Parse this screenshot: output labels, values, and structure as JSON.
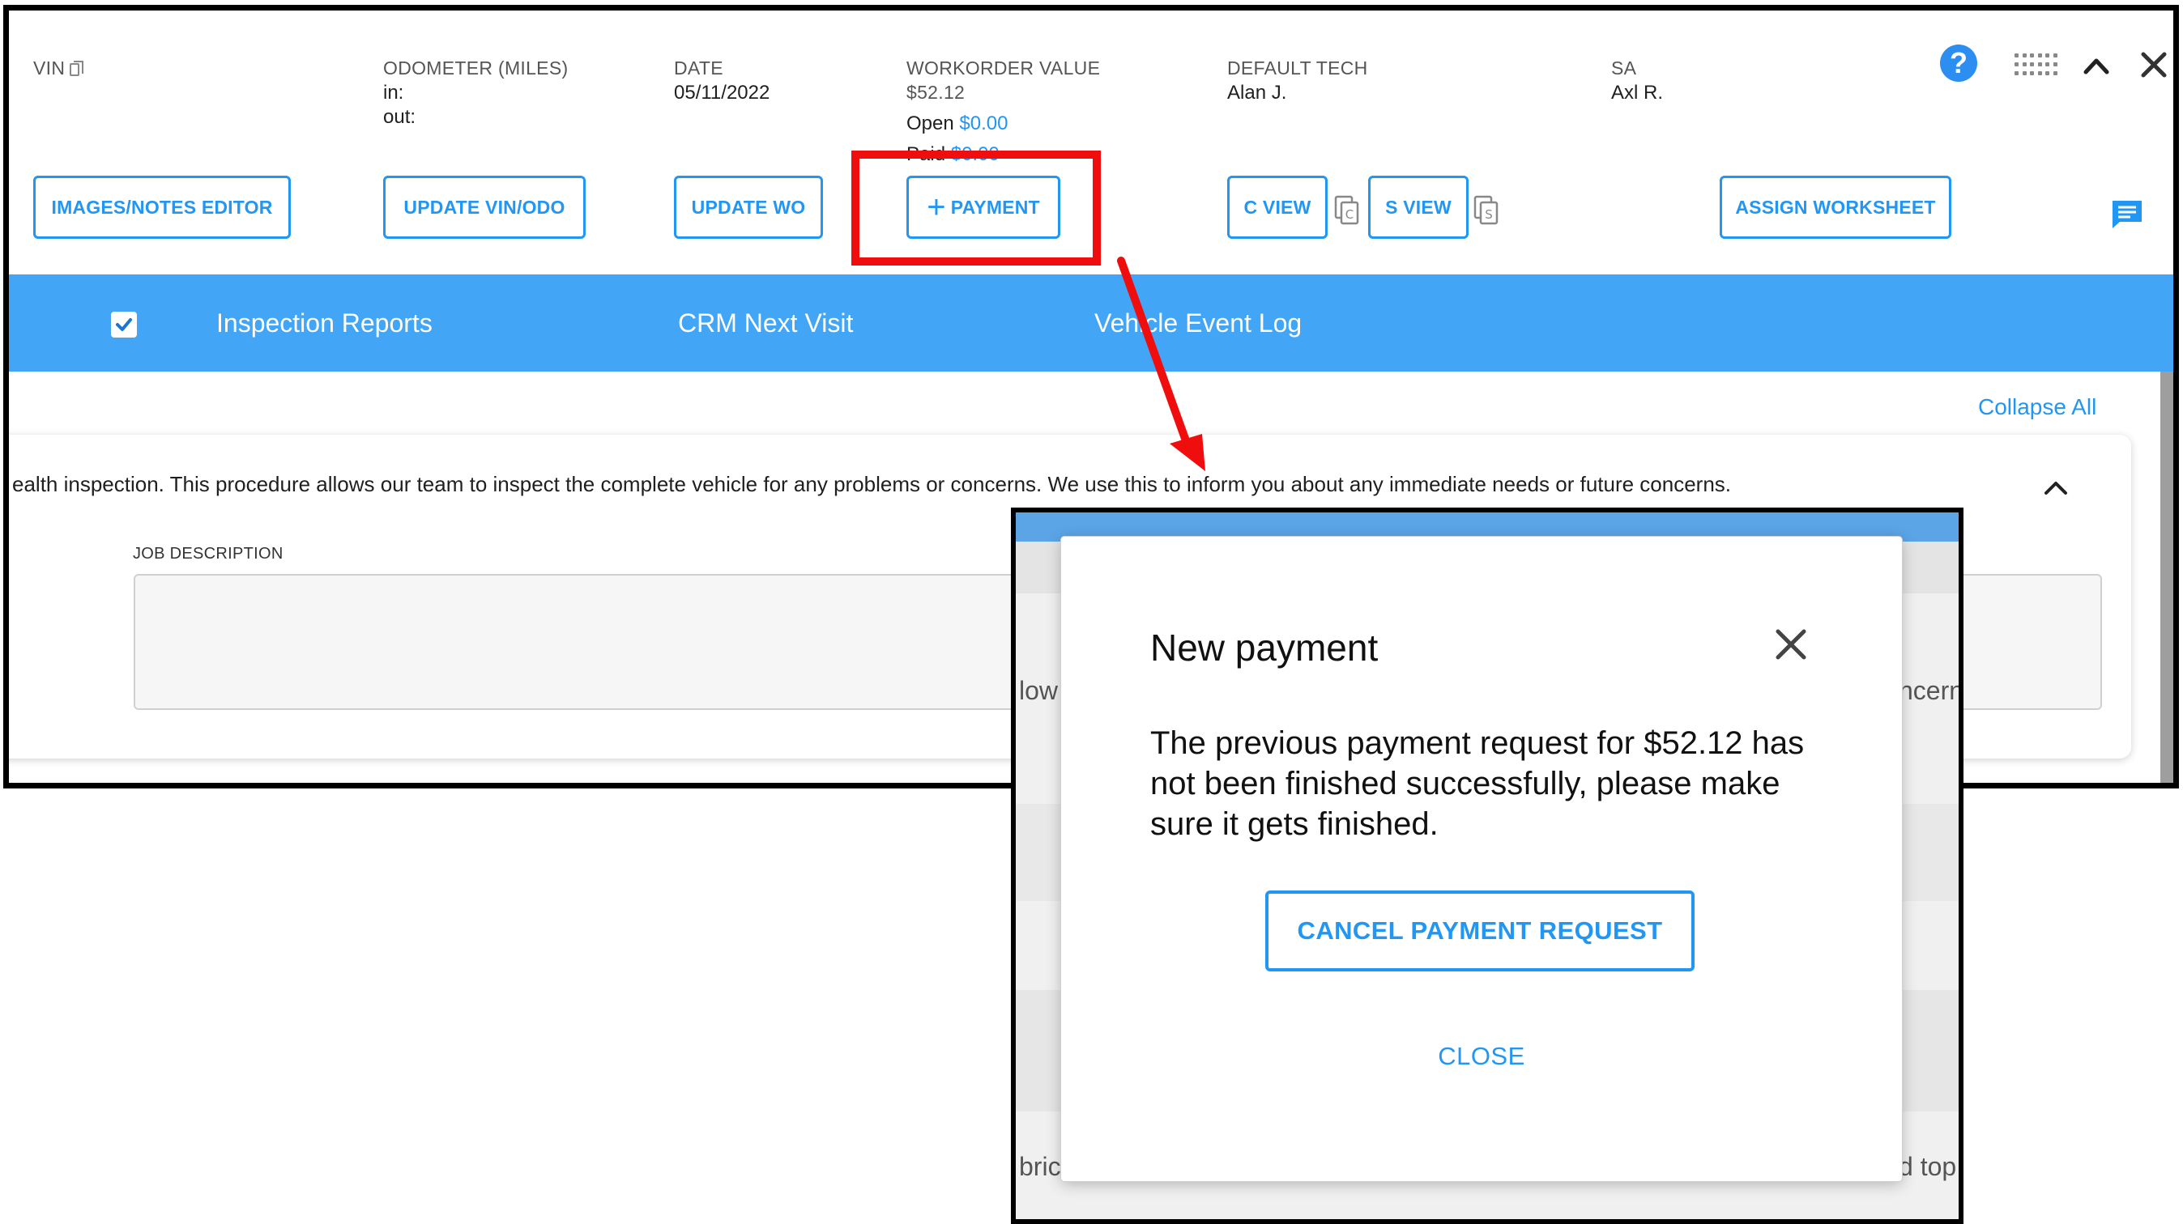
{
  "header": {
    "vin_label": "VIN",
    "odometer_label": "ODOMETER (MILES)",
    "odometer_in": "in:",
    "odometer_out": "out:",
    "date_label": "DATE",
    "date_value": "05/11/2022",
    "workorder_label": "WORKORDER VALUE",
    "workorder_value": "$52.12",
    "open_label": "Open",
    "open_value": "$0.00",
    "paid_label": "Paid",
    "paid_value": "$0.00",
    "tech_label": "DEFAULT TECH",
    "tech_value": "Alan J.",
    "sa_label": "SA",
    "sa_value": "Axl R.",
    "help_symbol": "?"
  },
  "toolbar": {
    "images_notes": "IMAGES/NOTES EDITOR",
    "update_vin_odo": "UPDATE VIN/ODO",
    "update_wo": "UPDATE WO",
    "payment": "PAYMENT",
    "payment_plus": "+",
    "c_view": "C VIEW",
    "s_view": "S VIEW",
    "assign_worksheet": "ASSIGN WORKSHEET"
  },
  "tabs": [
    {
      "label": "Inspection Reports"
    },
    {
      "label": "CRM Next Visit"
    },
    {
      "label": "Vehicle Event Log"
    }
  ],
  "content": {
    "collapse_all": "Collapse All",
    "inspection_text": "ealth inspection. This procedure allows our team to inspect the complete vehicle for any problems or concerns. We use this to inform you about any immediate needs or future concerns.",
    "job_description_label": "JOB DESCRIPTION"
  },
  "modal_background": {
    "frag_left_1": "low",
    "frag_right_1": "ncern",
    "frag_left_2": "bric",
    "frag_right_2": "d top"
  },
  "dialog": {
    "title": "New payment",
    "message": "The previous payment request for $52.12 has not been finished successfully, please make sure it gets finished.",
    "cancel_button": "CANCEL PAYMENT REQUEST",
    "close_link": "CLOSE"
  },
  "colors": {
    "accent": "#2196f3",
    "tab_bar": "#42a5f5",
    "annotation": "#ef0d0d"
  }
}
